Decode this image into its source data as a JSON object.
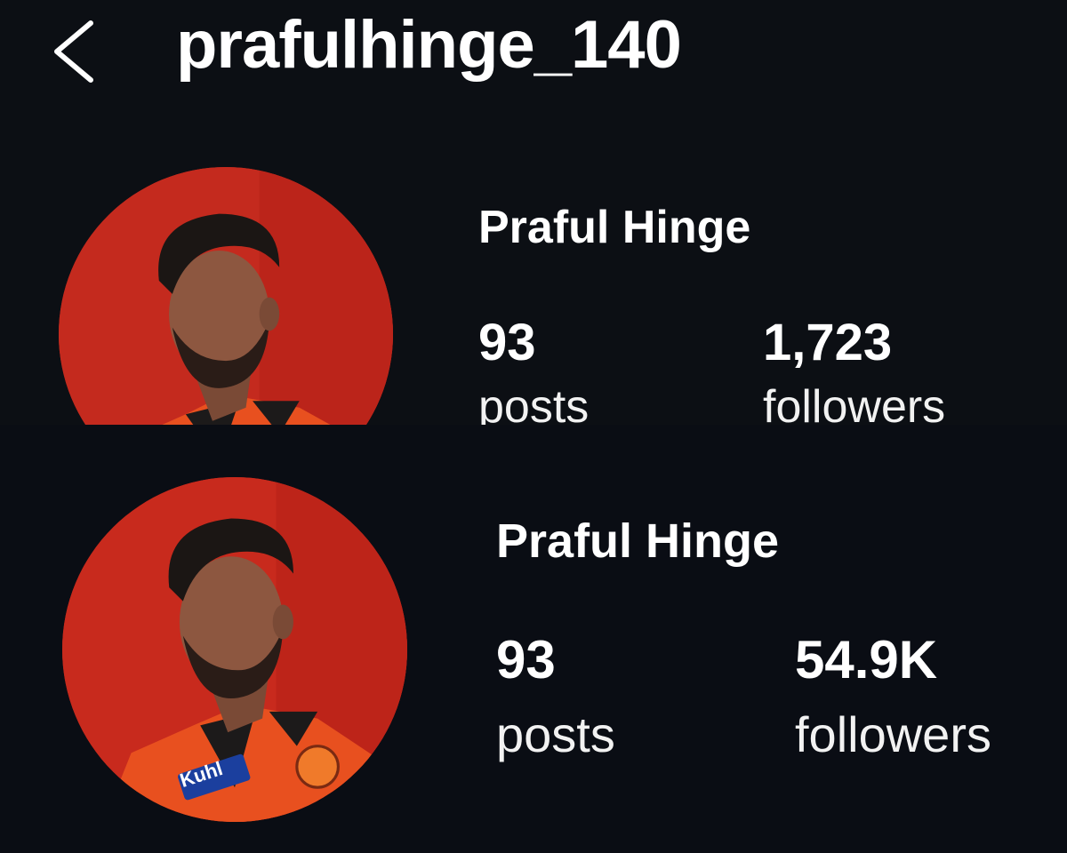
{
  "header": {
    "back_icon": "chevron-left-icon",
    "username": "prafulhinge_140"
  },
  "profile_before": {
    "display_name": "Praful Hinge",
    "posts_value": "93",
    "posts_label": "posts",
    "followers_value": "1,723",
    "followers_label": "followers"
  },
  "profile_after": {
    "display_name": "Praful Hinge",
    "posts_value": "93",
    "posts_label": "posts",
    "followers_value": "54.9K",
    "followers_label": "followers",
    "jersey_logo_text": "Kuhl"
  },
  "colors": {
    "background": "#0b0e13",
    "text": "#ffffff",
    "avatar_red": "#c82a1d",
    "jersey_orange": "#e8501f"
  }
}
